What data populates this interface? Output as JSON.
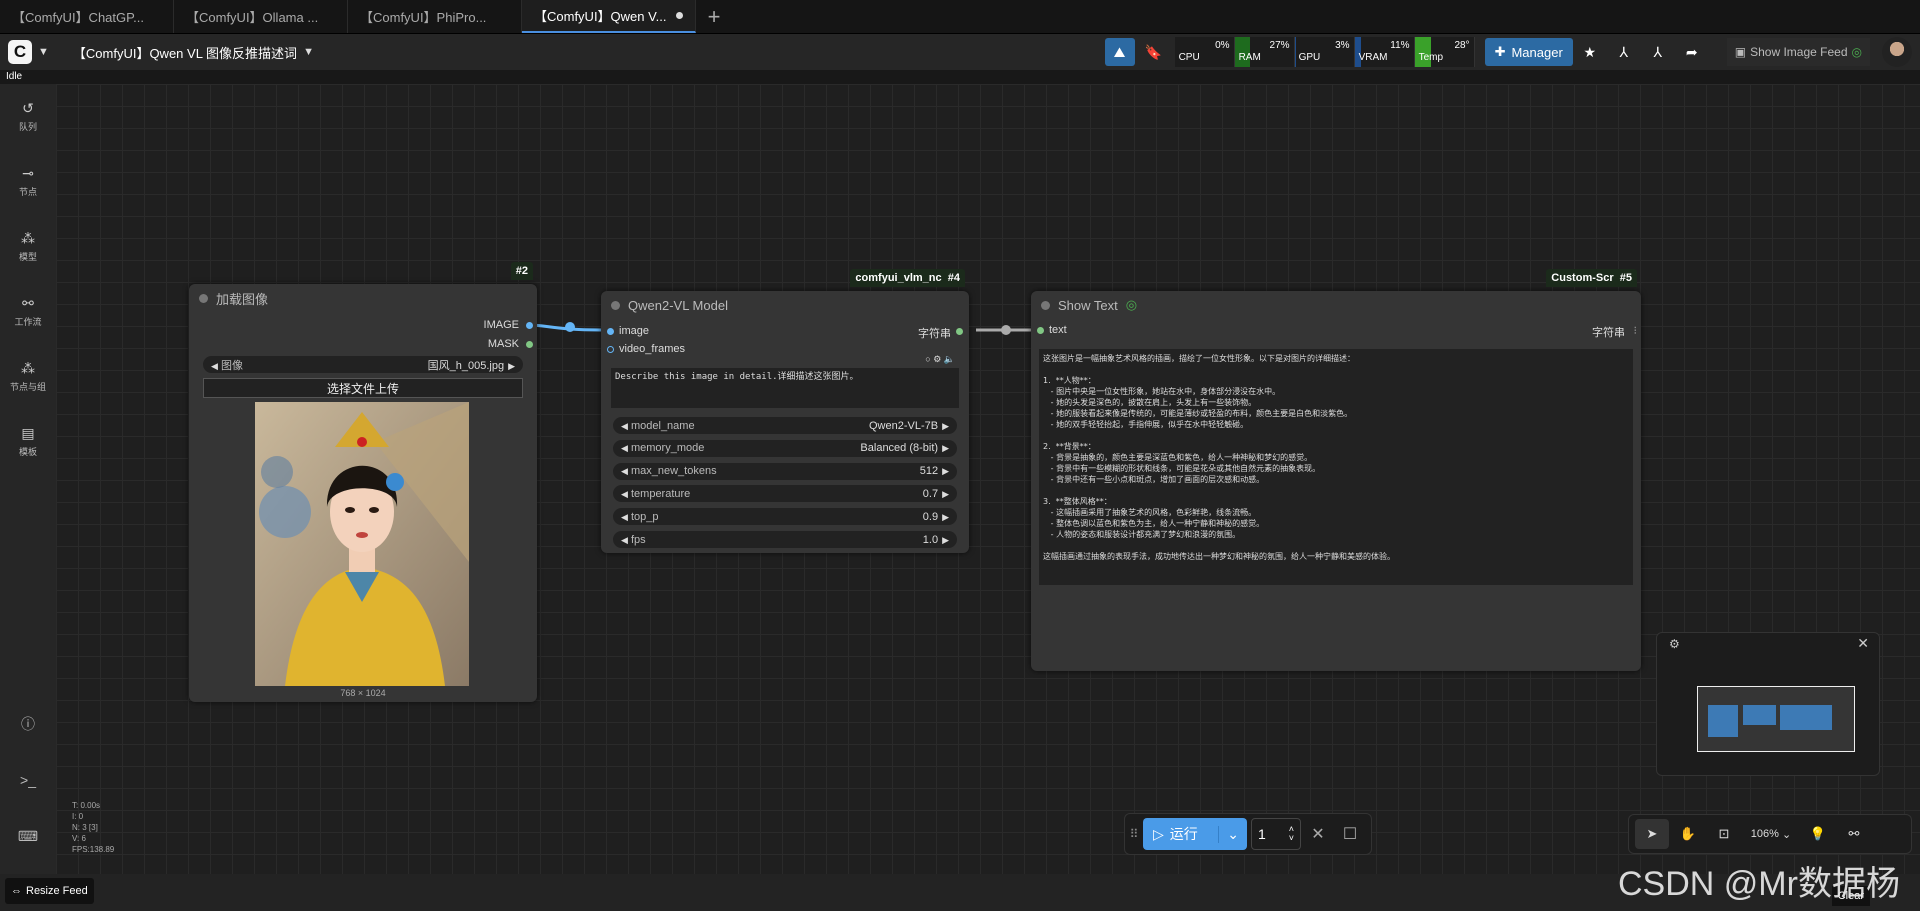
{
  "tabs": [
    {
      "label": "【ComfyUI】ChatGP..."
    },
    {
      "label": "【ComfyUI】Ollama ..."
    },
    {
      "label": "【ComfyUI】PhiPro..."
    },
    {
      "label": "【ComfyUI】Qwen V..."
    }
  ],
  "topbar": {
    "logo_letter": "C",
    "workflow_title": "【ComfyUI】Qwen VL 图像反推描述词",
    "monitors": [
      {
        "label": "CPU",
        "value": "0%",
        "fill": 0.0,
        "color": "#1c1c1c"
      },
      {
        "label": "RAM",
        "value": "27%",
        "fill": 0.27,
        "color": "#1e6b1e"
      },
      {
        "label": "GPU",
        "value": "3%",
        "fill": 0.03,
        "color": "#1e4d8c"
      },
      {
        "label": "VRAM",
        "value": "11%",
        "fill": 0.11,
        "color": "#1e4d8c"
      },
      {
        "label": "Temp",
        "value": "28°",
        "fill": 0.28,
        "color": "#3aa12a"
      }
    ],
    "manager_label": "Manager",
    "show_image_feed_label": "Show Image Feed"
  },
  "status": "Idle",
  "sidebar": [
    {
      "label": "队列",
      "icon": "history-icon"
    },
    {
      "label": "节点",
      "icon": "node-icon"
    },
    {
      "label": "模型",
      "icon": "model-icon"
    },
    {
      "label": "工作流",
      "icon": "workflow-icon"
    },
    {
      "label": "节点与组",
      "icon": "node-group-icon"
    },
    {
      "label": "模板",
      "icon": "template-icon"
    }
  ],
  "nodes": {
    "load_image": {
      "badge": "#2",
      "title": "加载图像",
      "out_image": "IMAGE",
      "out_mask": "MASK",
      "image_label": "图像",
      "image_value": "国风_h_005.jpg",
      "upload_label": "选择文件上传",
      "image_size": "768 × 1024"
    },
    "qwen": {
      "badge_name": "comfyui_vlm_nc",
      "badge": "#4",
      "title": "Qwen2-VL Model",
      "in_image": "image",
      "in_video": "video_frames",
      "out_string": "字符串",
      "prompt": "Describe this image in detail.详细描述这张图片。",
      "widgets": [
        {
          "name": "model_name",
          "value": "Qwen2-VL-7B"
        },
        {
          "name": "memory_mode",
          "value": "Balanced (8-bit)"
        },
        {
          "name": "max_new_tokens",
          "value": "512"
        },
        {
          "name": "temperature",
          "value": "0.7"
        },
        {
          "name": "top_p",
          "value": "0.9"
        },
        {
          "name": "fps",
          "value": "1.0"
        }
      ]
    },
    "show_text": {
      "badge_name": "Custom-Scr",
      "badge": "#5",
      "title": "Show Text",
      "in_text": "text",
      "out_string": "字符串",
      "content": "这张图片是一幅抽象艺术风格的插画，描绘了一位女性形象。以下是对图片的详细描述：\n\n1.  **人物**：\n   - 图片中央是一位女性形象，她站在水中，身体部分浸没在水中。\n   - 她的头发是深色的，披散在肩上，头发上有一些装饰物。\n   - 她的服装看起来像是传统的，可能是薄纱或轻盈的布料，颜色主要是白色和淡紫色。\n   - 她的双手轻轻抬起，手指伸展，似乎在水中轻轻触碰。\n\n2.  **背景**：\n   - 背景是抽象的，颜色主要是深蓝色和紫色，给人一种神秘和梦幻的感觉。\n   - 背景中有一些模糊的形状和线条，可能是花朵或其他自然元素的抽象表现。\n   - 背景中还有一些小点和斑点，增加了画面的层次感和动感。\n\n3.  **整体风格**：\n   - 这幅插画采用了抽象艺术的风格，色彩鲜艳，线条流畅。\n   - 整体色调以蓝色和紫色为主，给人一种宁静和神秘的感觉。\n   - 人物的姿态和服装设计都充满了梦幻和浪漫的氛围。\n\n这幅插画通过抽象的表现手法，成功地传达出一种梦幻和神秘的氛围，给人一种宁静和美感的体验。"
    }
  },
  "runbar": {
    "run_label": "运行",
    "count": "1"
  },
  "zoom": "106%",
  "stats": [
    "T: 0.00s",
    "I: 0",
    "N: 3 [3]",
    "V: 6",
    "FPS:138.89"
  ],
  "bottom": {
    "resize_feed": "Resize Feed",
    "clear": "Clear"
  },
  "watermark": "CSDN @Mr数据杨"
}
